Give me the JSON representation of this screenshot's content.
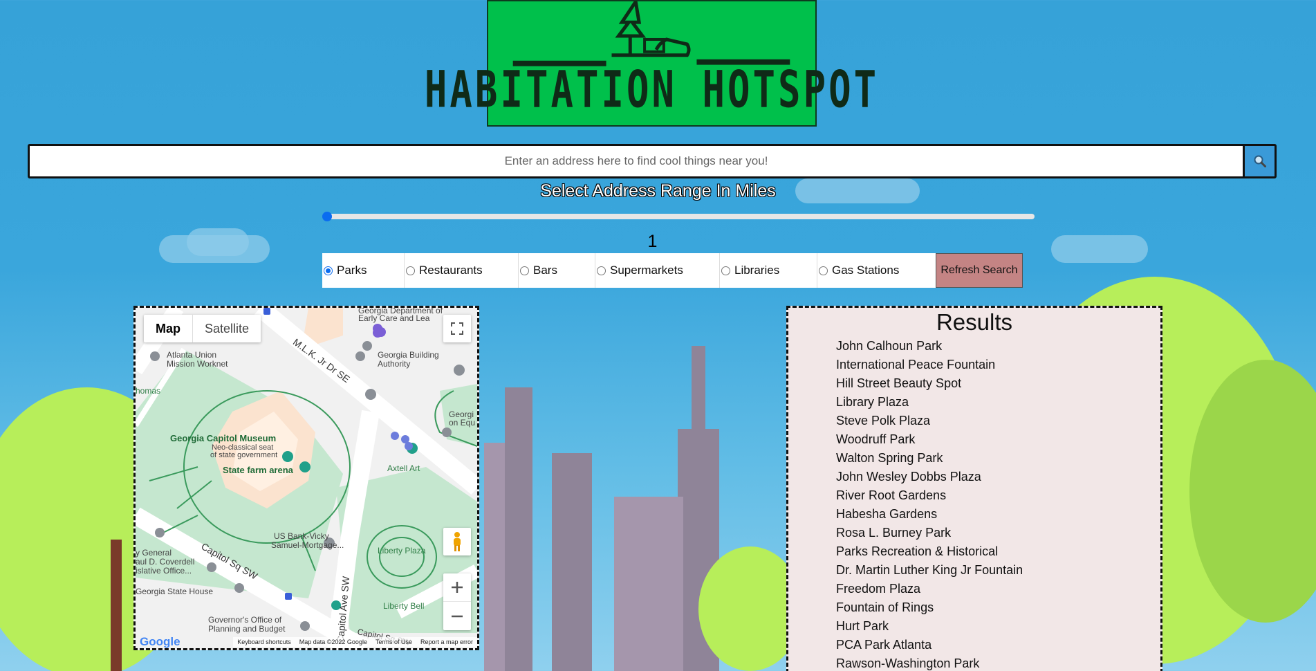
{
  "header": {
    "logo_text": "HABITATION HOTSPOT"
  },
  "search": {
    "placeholder": "Enter an address here to find cool things near you!",
    "button_icon": "search-icon"
  },
  "range": {
    "title": "Select Address Range In Miles",
    "value": "1"
  },
  "categories": [
    {
      "label": "Parks",
      "selected": true
    },
    {
      "label": "Restaurants",
      "selected": false
    },
    {
      "label": "Bars",
      "selected": false
    },
    {
      "label": "Supermarkets",
      "selected": false
    },
    {
      "label": "Libraries",
      "selected": false
    },
    {
      "label": "Gas Stations",
      "selected": false
    }
  ],
  "refresh_label": "Refresh Search",
  "map": {
    "type_map": "Map",
    "type_satellite": "Satellite",
    "labels": {
      "georgia_dept": "Georgia Department of",
      "early_care": "Early Care and Lea",
      "atlanta_union": "Atlanta Union",
      "mission_worknet": "Mission Worknet",
      "georgia_building": "Georgia Building",
      "authority": "Authority",
      "mlk_dr": "M.L.K. Jr Dr SE",
      "homas": "homas",
      "georgia_on_eq": "Georgi",
      "on_equ": "on Equ",
      "capitol_museum": "Georgia Capitol Museum",
      "neo_classical": "Neo-classical seat",
      "state_gov": "of state government",
      "state_farm": "State farm arena",
      "axtell": "Axtell Art",
      "us_bank": "US Bank-Vicky",
      "samuel": "Samuel-Mortgage...",
      "liberty_plaza": "Liberty Plaza",
      "liberty_bell": "Liberty Bell",
      "capitol_sq": "Capitol Sq SW",
      "capitol_ave": "Capitol Ave SW",
      "capitol_sw2": "Capitol Sq SW",
      "y_general": "y General",
      "coverdell": "aul D. Coverdell",
      "islative": "islative Office...",
      "state_house": "Georgia State House",
      "governor": "Governor's Office of",
      "planning": "Planning and Budget"
    },
    "footer": {
      "google": "Google",
      "shortcuts": "Keyboard shortcuts",
      "map_data": "Map data ©2022 Google",
      "terms": "Terms of Use",
      "report": "Report a map error"
    }
  },
  "results": {
    "title": "Results",
    "items": [
      "John Calhoun Park",
      "International Peace Fountain",
      "Hill Street Beauty Spot",
      "Library Plaza",
      "Steve Polk Plaza",
      "Woodruff Park",
      "Walton Spring Park",
      "John Wesley Dobbs Plaza",
      "River Root Gardens",
      "Habesha Gardens",
      "Rosa L. Burney Park",
      "Parks Recreation & Historical",
      "Dr. Martin Luther King Jr Fountain",
      "Freedom Plaza",
      "Fountain of Rings",
      "Hurt Park",
      "PCA Park Atlanta",
      "Rawson-Washington Park"
    ]
  }
}
